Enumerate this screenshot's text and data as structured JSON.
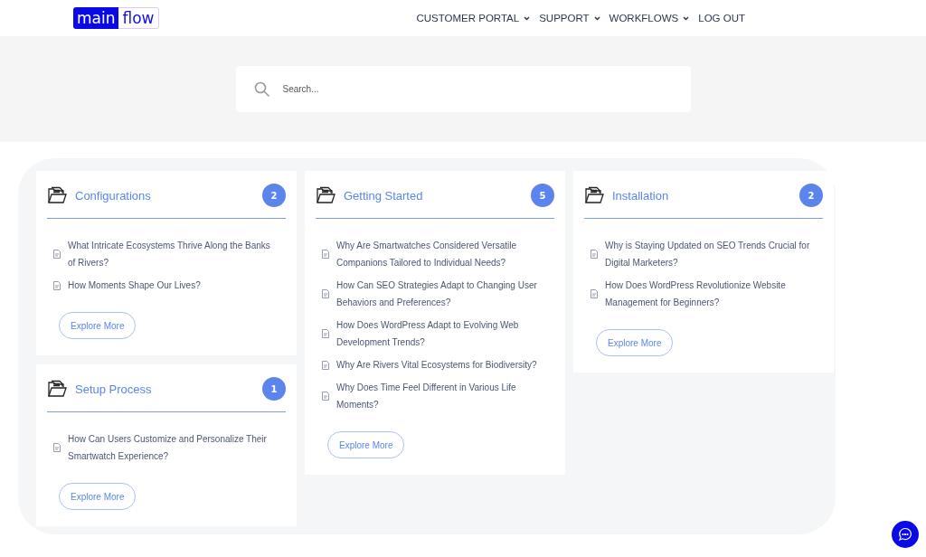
{
  "logo": {
    "part_1": "main",
    "part_2": "flow"
  },
  "nav": [
    {
      "label": "CUSTOMER PORTAL",
      "dropdown": true
    },
    {
      "label": "SUPPORT",
      "dropdown": true
    },
    {
      "label": "WORKFLOWS",
      "dropdown": true
    },
    {
      "label": "LOG OUT",
      "dropdown": false
    }
  ],
  "search": {
    "placeholder": "Search..."
  },
  "columns": [
    [
      {
        "title": "Configurations",
        "count": "2",
        "articles": [
          "What Intricate Ecosystems Thrive Along the Banks of Rivers?",
          "How Moments Shape Our Lives?"
        ],
        "button": "Explore More"
      },
      {
        "title": "Setup Process",
        "count": "1",
        "articles": [
          "How Can Users Customize and Personalize Their Smartwatch Experience?"
        ],
        "button": "Explore More"
      }
    ],
    [
      {
        "title": "Getting Started",
        "count": "5",
        "articles": [
          "Why Are Smartwatches Considered Versatile Companions Tailored to Individual Needs?",
          "How Can SEO Strategies Adapt to Changing User Behaviors and Preferences?",
          "How Does WordPress Adapt to Evolving Web Development Trends?",
          "Why Are Rivers Vital Ecosystems for Biodiversity?",
          "Why Does Time Feel Different in Various Life Moments?"
        ],
        "button": "Explore More"
      }
    ],
    [
      {
        "title": "Installation",
        "count": "2",
        "articles": [
          "Why is Staying Updated on SEO Trends Crucial for Digital Marketers?",
          "How Does WordPress Revolutionize Website Management for Beginners?"
        ],
        "button": "Explore More"
      }
    ]
  ]
}
